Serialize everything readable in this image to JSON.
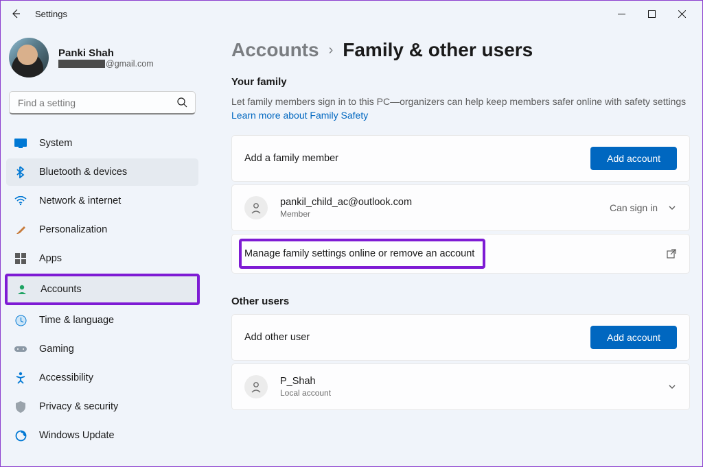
{
  "app": {
    "title": "Settings"
  },
  "profile": {
    "name": "Panki Shah",
    "email_suffix": "@gmail.com"
  },
  "search": {
    "placeholder": "Find a setting"
  },
  "nav": [
    {
      "label": "System"
    },
    {
      "label": "Bluetooth & devices"
    },
    {
      "label": "Network & internet"
    },
    {
      "label": "Personalization"
    },
    {
      "label": "Apps"
    },
    {
      "label": "Accounts"
    },
    {
      "label": "Time & language"
    },
    {
      "label": "Gaming"
    },
    {
      "label": "Accessibility"
    },
    {
      "label": "Privacy & security"
    },
    {
      "label": "Windows Update"
    }
  ],
  "breadcrumb": {
    "parent": "Accounts",
    "current": "Family & other users"
  },
  "family": {
    "title": "Your family",
    "desc": "Let family members sign in to this PC—organizers can help keep members safer online with safety settings  ",
    "link": "Learn more about Family Safety",
    "add_label": "Add a family member",
    "add_button": "Add account",
    "member_email": "pankil_child_ac@outlook.com",
    "member_role": "Member",
    "member_status": "Can sign in",
    "manage_label": "Manage family settings online or remove an account"
  },
  "other": {
    "title": "Other users",
    "add_label": "Add other user",
    "add_button": "Add account",
    "user_name": "P_Shah",
    "user_type": "Local account"
  }
}
